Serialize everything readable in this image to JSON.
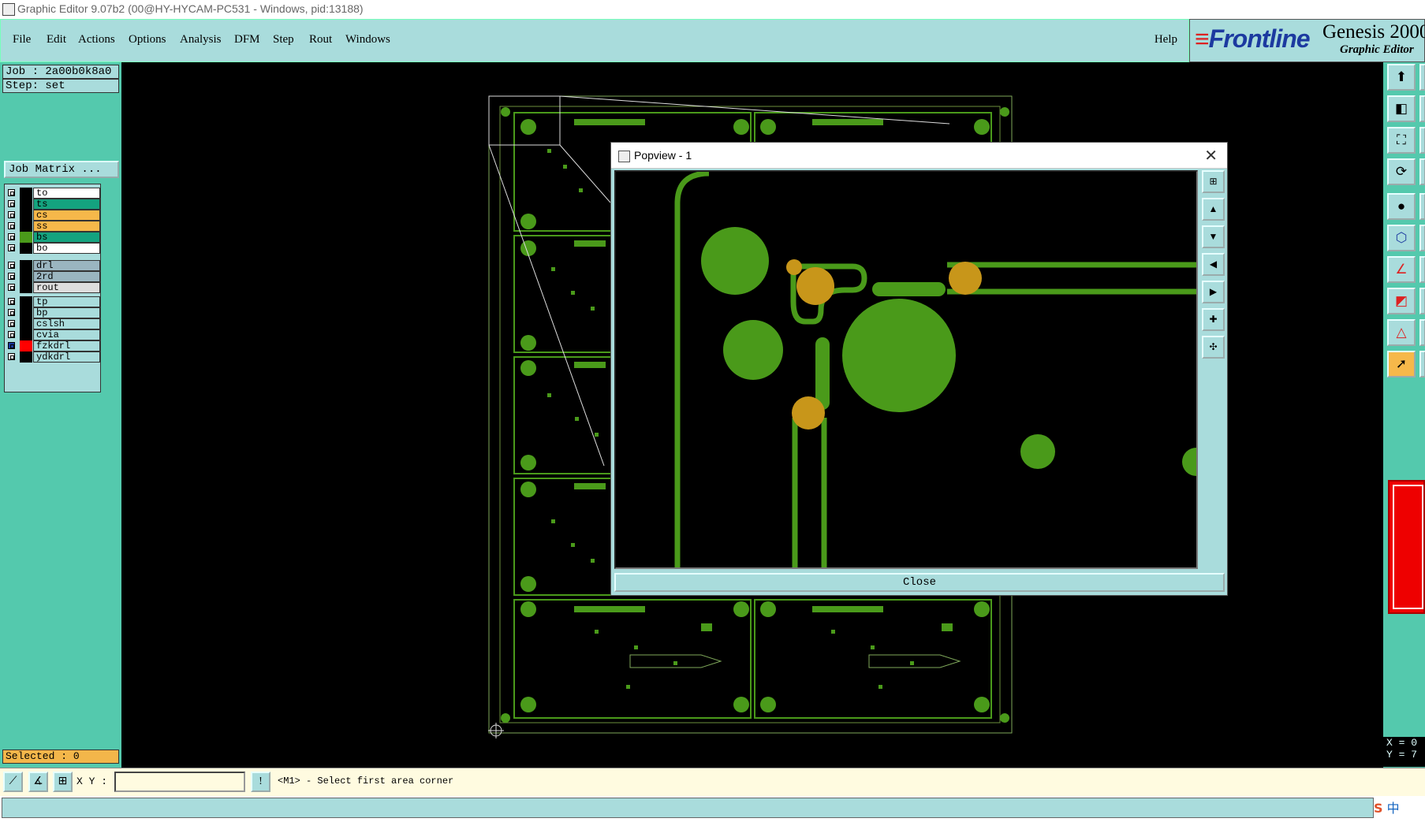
{
  "window": {
    "title": "Graphic Editor 9.07b2 (00@HY-HYCAM-PC531 - Windows, pid:13188)"
  },
  "menu": {
    "items": [
      "File",
      "Edit",
      "Actions",
      "Options",
      "Analysis",
      "DFM",
      "Step",
      "Rout",
      "Windows"
    ],
    "help": "Help"
  },
  "brand": {
    "logo": "Frontline",
    "product": "Genesis 2000",
    "subtitle": "Graphic Editor"
  },
  "job": {
    "job_line": "Job : 2a00b0k8a0",
    "step_line": "Step: set",
    "matrix_button": "Job Matrix ..."
  },
  "layers": [
    {
      "name": "to",
      "color": "#ffffff",
      "swatch": "#000000"
    },
    {
      "name": "ts",
      "color": "#14a37f",
      "swatch": "#000000"
    },
    {
      "name": "cs",
      "color": "#f6b84a",
      "swatch": "#000000"
    },
    {
      "name": "ss",
      "color": "#f6b84a",
      "swatch": "#000000"
    },
    {
      "name": "bs",
      "color": "#14a37f",
      "swatch": "#4a9a1a"
    },
    {
      "name": "bo",
      "color": "#ffffff",
      "swatch": "#000000"
    },
    {
      "name": "drl",
      "color": "#9ab5c0",
      "swatch": "#000000"
    },
    {
      "name": "2rd",
      "color": "#9ab5c0",
      "swatch": "#000000"
    },
    {
      "name": "rout",
      "color": "#dddddd",
      "swatch": "#000000"
    },
    {
      "name": "tp",
      "color": "#a9dcdc",
      "swatch": "#000000"
    },
    {
      "name": "bp",
      "color": "#a9dcdc",
      "swatch": "#000000"
    },
    {
      "name": "cslsh",
      "color": "#a9dcdc",
      "swatch": "#000000"
    },
    {
      "name": "cvia",
      "color": "#a9dcdc",
      "swatch": "#000000"
    },
    {
      "name": "fzkdrl",
      "color": "#a9dcdc",
      "swatch": "#ff0000"
    },
    {
      "name": "ydkdrl",
      "color": "#a9dcdc",
      "swatch": "#000000"
    }
  ],
  "selection": {
    "label": "Selected : 0"
  },
  "command": {
    "xy_label": "X Y :",
    "xy_value": "",
    "prompt": "<M1> - Select first area corner"
  },
  "coords": {
    "x": "X = 0",
    "y": "Y = 7"
  },
  "popview": {
    "title": "Popview - 1",
    "close_button": "Close"
  },
  "ime": {
    "label": "中"
  }
}
